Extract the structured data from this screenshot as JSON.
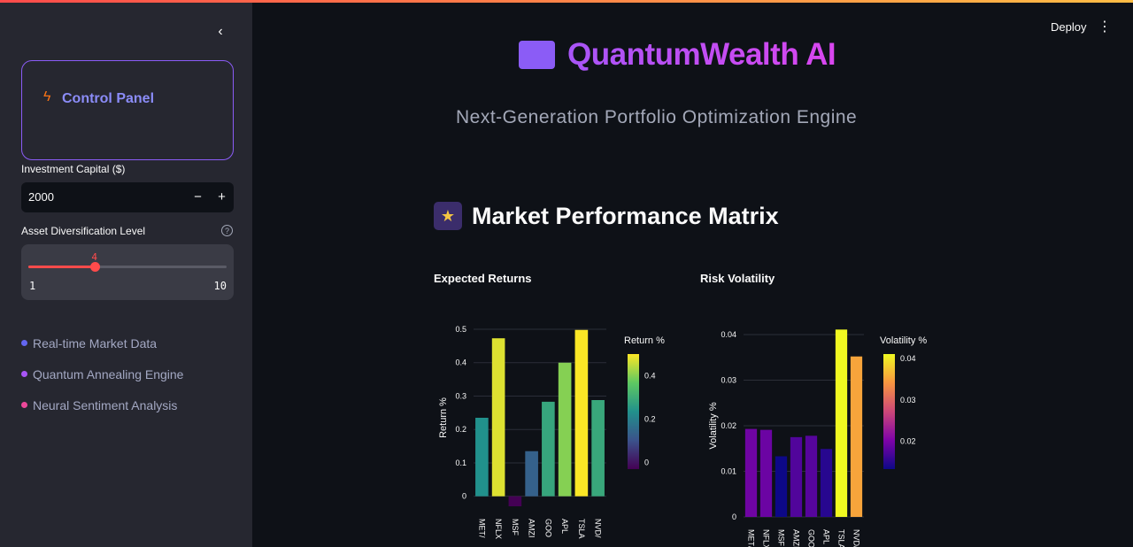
{
  "sidebar": {
    "control_panel": "Control Panel",
    "capital_label": "Investment Capital ($)",
    "capital_value": "2000",
    "minus": "−",
    "plus": "+",
    "diversification_label": "Asset Diversification Level",
    "slider": {
      "value": 4,
      "min": 1,
      "max": 10,
      "value_label": "4",
      "min_label": "1",
      "max_label": "10"
    },
    "features": [
      {
        "label": "Real-time Market Data",
        "color": "#6366f1"
      },
      {
        "label": "Quantum Annealing Engine",
        "color": "#a855f7"
      },
      {
        "label": "Neural Sentiment Analysis",
        "color": "#ec4899"
      }
    ]
  },
  "header": {
    "deploy": "Deploy"
  },
  "hero": {
    "title": "QuantumWealth AI",
    "subtitle": "Next-Generation Portfolio Optimization Engine"
  },
  "section": {
    "title": "Market Performance Matrix"
  },
  "colors": {
    "accent": "#8b5cf6",
    "slider": "#ff4b4b"
  },
  "chart_data": [
    {
      "type": "bar",
      "title": "Expected Returns",
      "ylabel": "Return %",
      "categories": [
        "META",
        "NFLX",
        "MSFT",
        "AMZN",
        "GOOGL",
        "AAPL",
        "TSLA",
        "NVDA"
      ],
      "tick_labels": [
        "MET/",
        "NFLX",
        "MSF",
        "AMZI",
        "GOO",
        "APL",
        "TSLA",
        "NVD/"
      ],
      "values": [
        0.235,
        0.473,
        -0.03,
        0.135,
        0.283,
        0.4,
        0.498,
        0.288
      ],
      "ylim": [
        -0.03,
        0.5
      ],
      "yticks": [
        0,
        0.1,
        0.2,
        0.3,
        0.4,
        0.5
      ],
      "colorbar": {
        "title": "Return %",
        "ticks": [
          0,
          0.2,
          0.4
        ],
        "range": [
          -0.03,
          0.5
        ],
        "colorscale": "viridis"
      }
    },
    {
      "type": "bar",
      "title": "Risk Volatility",
      "ylabel": "Volatility %",
      "categories": [
        "META",
        "NFLX",
        "MSFT",
        "AMZN",
        "GOOGL",
        "AAPL",
        "TSLA",
        "NVDA"
      ],
      "tick_labels": [
        "MET/",
        "NFLX",
        "MSF",
        "AMZI",
        "GOO",
        "APL",
        "TSLA",
        "NVD/"
      ],
      "values": [
        0.0193,
        0.0191,
        0.0133,
        0.0175,
        0.0178,
        0.0149,
        0.0411,
        0.0352
      ],
      "ylim": [
        0,
        0.04
      ],
      "yticks": [
        0,
        0.01,
        0.02,
        0.03,
        0.04
      ],
      "colorbar": {
        "title": "Volatility %",
        "ticks": [
          0.02,
          0.03,
          0.04
        ],
        "range": [
          0.0133,
          0.0411
        ],
        "colorscale": "plasma"
      }
    }
  ]
}
